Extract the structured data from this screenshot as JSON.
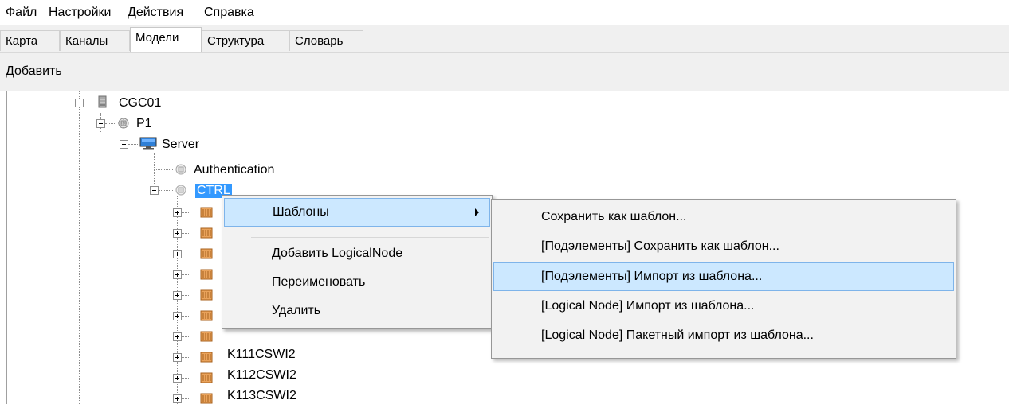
{
  "menubar": {
    "items": [
      "Файл",
      "Настройки",
      "Действия",
      "Справка"
    ]
  },
  "tabs": {
    "items": [
      "Карта",
      "Каналы",
      "Модели",
      "Структура",
      "Словарь"
    ],
    "active": "Модели"
  },
  "toolbar": {
    "add_label": "Добавить"
  },
  "tree": {
    "nodes": [
      {
        "label": "CGC01",
        "icon": "server-rack-icon",
        "expanded": true
      },
      {
        "label": "P1",
        "icon": "gear-cube-icon",
        "expanded": true
      },
      {
        "label": "Server",
        "icon": "monitor-icon",
        "expanded": true
      },
      {
        "label": "Authentication",
        "icon": "gear-cube-icon"
      },
      {
        "label": "CTRL",
        "icon": "gear-cube-icon",
        "expanded": true,
        "selected": true
      },
      {
        "label": "K111CSWI2",
        "icon": "logical-node-icon",
        "expanded": false
      },
      {
        "label": "K112CSWI2",
        "icon": "logical-node-icon",
        "expanded": false
      },
      {
        "label": "K113CSWI2",
        "icon": "logical-node-icon",
        "expanded": false
      }
    ]
  },
  "context_menu": {
    "items": [
      "Шаблоны",
      "Добавить LogicalNode",
      "Переименовать",
      "Удалить"
    ],
    "highlighted": "Шаблоны"
  },
  "submenu": {
    "items": [
      "Сохранить как шаблон...",
      "[Подэлементы] Сохранить как шаблон...",
      "[Подэлементы] Импорт из шаблона...",
      "[Logical Node] Импорт из шаблона...",
      "[Logical Node] Пакетный импорт из шаблона..."
    ],
    "highlighted": "[Подэлементы] Импорт из шаблона..."
  },
  "colors": {
    "selection": "#3399ff",
    "menu_highlight": "#cce8ff",
    "menu_highlight_border": "#7eb4ea"
  }
}
